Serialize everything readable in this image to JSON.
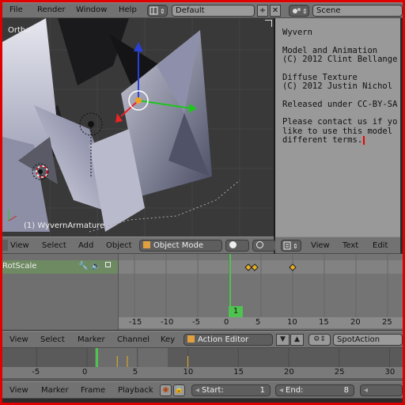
{
  "menu": {
    "file": "File",
    "render": "Render",
    "window": "Window",
    "help": "Help"
  },
  "layout": {
    "value": "Default"
  },
  "scene": {
    "value": "Scene"
  },
  "viewport": {
    "view_label": "Ortho",
    "object_label": "(1) WyvernArmature",
    "menu": {
      "view": "View",
      "select": "Select",
      "add": "Add",
      "object": "Object"
    },
    "mode": "Object Mode"
  },
  "text_editor": {
    "lines": [
      "Wyvern",
      "",
      "Model and Animation",
      "(C) 2012 Clint Bellange",
      "",
      "Diffuse Texture",
      "(C) 2012 Justin Nichol",
      "",
      "Released under CC-BY-SA",
      "",
      "Please contact us if yo",
      "like to use this model",
      "different terms."
    ],
    "menu": {
      "view": "View",
      "text": "Text",
      "edit": "Edit"
    }
  },
  "dopesheet": {
    "channel": "RotScale",
    "current_frame": "1",
    "ticks": [
      "-15",
      "-10",
      "-5",
      "0",
      "5",
      "10",
      "15",
      "20",
      "25"
    ],
    "keyframes": [
      3,
      4,
      10
    ],
    "menu": {
      "view": "View",
      "select": "Select",
      "marker": "Marker",
      "channel": "Channel",
      "key": "Key"
    },
    "editor": "Action Editor",
    "action": "SpotAction"
  },
  "timeline": {
    "ticks": [
      "-5",
      "0",
      "5",
      "10",
      "15",
      "20",
      "25",
      "30"
    ],
    "menu": {
      "view": "View",
      "marker": "Marker",
      "frame": "Frame",
      "playback": "Playback"
    },
    "start_label": "Start:",
    "start_value": "1",
    "end_label": "End:",
    "end_value": "8"
  },
  "colors": {
    "accent": "#4fc34f",
    "border": "#e00000",
    "keyframe": "#e8b020"
  }
}
